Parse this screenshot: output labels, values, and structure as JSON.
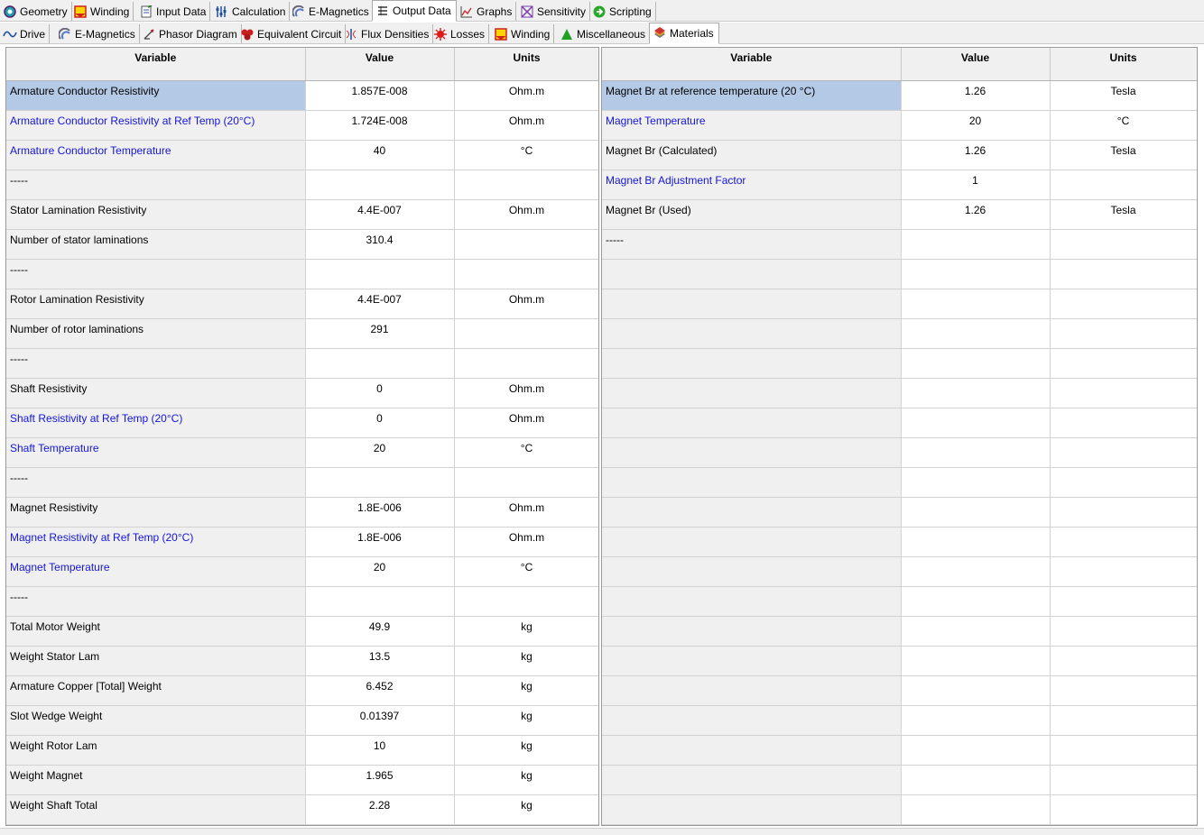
{
  "tabs_main": [
    {
      "label": "Geometry",
      "icon": "geometry-icon"
    },
    {
      "label": "Winding",
      "icon": "winding-icon"
    },
    {
      "label": "Input Data",
      "icon": "input-data-icon"
    },
    {
      "label": "Calculation",
      "icon": "calculation-icon"
    },
    {
      "label": "E-Magnetics",
      "icon": "e-magnetics-icon"
    },
    {
      "label": "Output Data",
      "icon": "output-data-icon"
    },
    {
      "label": "Graphs",
      "icon": "graphs-icon"
    },
    {
      "label": "Sensitivity",
      "icon": "sensitivity-icon"
    },
    {
      "label": "Scripting",
      "icon": "scripting-icon"
    }
  ],
  "tabs_sub": [
    {
      "label": "Drive",
      "icon": "drive-icon"
    },
    {
      "label": "E-Magnetics",
      "icon": "e-magnetics-icon"
    },
    {
      "label": "Phasor Diagram",
      "icon": "phasor-diagram-icon"
    },
    {
      "label": "Equivalent Circuit",
      "icon": "equivalent-circuit-icon"
    },
    {
      "label": "Flux Densities",
      "icon": "flux-densities-icon"
    },
    {
      "label": "Losses",
      "icon": "losses-icon"
    },
    {
      "label": "Winding",
      "icon": "winding-icon"
    },
    {
      "label": "Miscellaneous",
      "icon": "miscellaneous-icon"
    },
    {
      "label": "Materials",
      "icon": "materials-icon"
    }
  ],
  "active_main_tab": "Output Data",
  "active_sub_tab": "Materials",
  "columns": {
    "variable": "Variable",
    "value": "Value",
    "units": "Units"
  },
  "left_table": [
    {
      "variable": "Armature Conductor Resistivity",
      "value": "1.857E-008",
      "units": "Ohm.m",
      "link": false,
      "selected": true
    },
    {
      "variable": "Armature Conductor Resistivity at Ref Temp (20°C)",
      "value": "1.724E-008",
      "units": "Ohm.m",
      "link": true
    },
    {
      "variable": "Armature Conductor Temperature",
      "value": "40",
      "units": "°C",
      "link": true
    },
    {
      "variable": "-----",
      "value": "",
      "units": "",
      "link": false
    },
    {
      "variable": "Stator Lamination Resistivity",
      "value": "4.4E-007",
      "units": "Ohm.m",
      "link": false
    },
    {
      "variable": "Number of stator laminations",
      "value": "310.4",
      "units": "",
      "link": false
    },
    {
      "variable": "-----",
      "value": "",
      "units": "",
      "link": false
    },
    {
      "variable": "Rotor Lamination Resistivity",
      "value": "4.4E-007",
      "units": "Ohm.m",
      "link": false
    },
    {
      "variable": "Number of rotor laminations",
      "value": "291",
      "units": "",
      "link": false
    },
    {
      "variable": "-----",
      "value": "",
      "units": "",
      "link": false
    },
    {
      "variable": "Shaft Resistivity",
      "value": "0",
      "units": "Ohm.m",
      "link": false
    },
    {
      "variable": "Shaft Resistivity at Ref Temp (20°C)",
      "value": "0",
      "units": "Ohm.m",
      "link": true
    },
    {
      "variable": "Shaft Temperature",
      "value": "20",
      "units": "°C",
      "link": true
    },
    {
      "variable": "-----",
      "value": "",
      "units": "",
      "link": false
    },
    {
      "variable": "Magnet Resistivity",
      "value": "1.8E-006",
      "units": "Ohm.m",
      "link": false
    },
    {
      "variable": "Magnet Resistivity at Ref Temp (20°C)",
      "value": "1.8E-006",
      "units": "Ohm.m",
      "link": true
    },
    {
      "variable": "Magnet Temperature",
      "value": "20",
      "units": "°C",
      "link": true
    },
    {
      "variable": "-----",
      "value": "",
      "units": "",
      "link": false
    },
    {
      "variable": "Total Motor Weight",
      "value": "49.9",
      "units": "kg",
      "link": false
    },
    {
      "variable": "Weight Stator Lam",
      "value": "13.5",
      "units": "kg",
      "link": false
    },
    {
      "variable": "Armature Copper [Total] Weight",
      "value": "6.452",
      "units": "kg",
      "link": false
    },
    {
      "variable": "Slot Wedge Weight",
      "value": "0.01397",
      "units": "kg",
      "link": false
    },
    {
      "variable": "Weight Rotor Lam",
      "value": "10",
      "units": "kg",
      "link": false
    },
    {
      "variable": "Weight Magnet",
      "value": "1.965",
      "units": "kg",
      "link": false
    },
    {
      "variable": "Weight Shaft Total",
      "value": "2.28",
      "units": "kg",
      "link": false
    }
  ],
  "right_table": [
    {
      "variable": "Magnet Br at reference temperature (20 °C)",
      "value": "1.26",
      "units": "Tesla",
      "link": false,
      "selected": true
    },
    {
      "variable": "Magnet Temperature",
      "value": "20",
      "units": "°C",
      "link": true
    },
    {
      "variable": "Magnet Br (Calculated)",
      "value": "1.26",
      "units": "Tesla",
      "link": false
    },
    {
      "variable": "Magnet Br Adjustment Factor",
      "value": "1",
      "units": "",
      "link": true
    },
    {
      "variable": "Magnet Br (Used)",
      "value": "1.26",
      "units": "Tesla",
      "link": false
    },
    {
      "variable": "-----",
      "value": "",
      "units": "",
      "link": false
    },
    {
      "variable": "",
      "value": "",
      "units": ""
    },
    {
      "variable": "",
      "value": "",
      "units": ""
    },
    {
      "variable": "",
      "value": "",
      "units": ""
    },
    {
      "variable": "",
      "value": "",
      "units": ""
    },
    {
      "variable": "",
      "value": "",
      "units": ""
    },
    {
      "variable": "",
      "value": "",
      "units": ""
    },
    {
      "variable": "",
      "value": "",
      "units": ""
    },
    {
      "variable": "",
      "value": "",
      "units": ""
    },
    {
      "variable": "",
      "value": "",
      "units": ""
    },
    {
      "variable": "",
      "value": "",
      "units": ""
    },
    {
      "variable": "",
      "value": "",
      "units": ""
    },
    {
      "variable": "",
      "value": "",
      "units": ""
    },
    {
      "variable": "",
      "value": "",
      "units": ""
    },
    {
      "variable": "",
      "value": "",
      "units": ""
    },
    {
      "variable": "",
      "value": "",
      "units": ""
    },
    {
      "variable": "",
      "value": "",
      "units": ""
    },
    {
      "variable": "",
      "value": "",
      "units": ""
    },
    {
      "variable": "",
      "value": "",
      "units": ""
    },
    {
      "variable": "",
      "value": "",
      "units": ""
    }
  ],
  "colors": {
    "link": "#1515d6",
    "selected_row": "#b4c9e6",
    "header_bg": "#f0f0f0"
  }
}
